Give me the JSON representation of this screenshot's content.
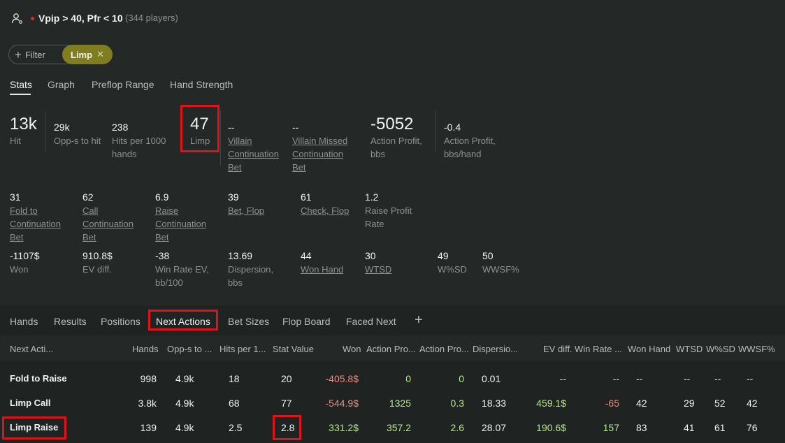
{
  "header": {
    "title": "Vpip > 40, Pfr < 10",
    "subtitle": "(344 players)"
  },
  "filters": {
    "add_label": "Filter",
    "active_chip": "Limp"
  },
  "tabs": [
    "Stats",
    "Graph",
    "Preflop Range",
    "Hand Strength"
  ],
  "stats_row1": [
    {
      "value": "13k",
      "label": "Hit"
    },
    {
      "value": "29k",
      "label": "Opp-s to hit"
    },
    {
      "value": "238",
      "label": "Hits per 1000 hands"
    },
    {
      "value": "47",
      "label": "Limp"
    },
    {
      "value": "--",
      "label": "Villain Continuation Bet"
    },
    {
      "value": "--",
      "label": "Villain Missed Continuation Bet"
    },
    {
      "value": "-5052",
      "label": "Action Profit, bbs"
    },
    {
      "value": "-0.4",
      "label": "Action Profit, bbs/hand"
    }
  ],
  "stats_row2": [
    {
      "value": "31",
      "label": "Fold to Continuation Bet"
    },
    {
      "value": "62",
      "label": "Call Continuation Bet"
    },
    {
      "value": "6.9",
      "label": "Raise Continuation Bet"
    },
    {
      "value": "39",
      "label": "Bet, Flop"
    },
    {
      "value": "61",
      "label": "Check, Flop"
    },
    {
      "value": "1.2",
      "label": "Raise Profit Rate"
    }
  ],
  "stats_row3": [
    {
      "value": "-1107$",
      "label": "Won"
    },
    {
      "value": "910.8$",
      "label": "EV diff."
    },
    {
      "value": "-38",
      "label": "Win Rate EV, bb/100"
    },
    {
      "value": "13.69",
      "label": "Dispersion, bbs"
    },
    {
      "value": "44",
      "label": "Won Hand"
    },
    {
      "value": "30",
      "label": "WTSD"
    },
    {
      "value": "49",
      "label": "W%SD"
    },
    {
      "value": "50",
      "label": "WWSF%"
    }
  ],
  "lower_tabs": [
    "Hands",
    "Results",
    "Positions",
    "Next Actions",
    "Bet Sizes",
    "Flop Board",
    "Faced Next",
    "+"
  ],
  "table": {
    "columns": [
      "Next Acti...",
      "Hands",
      "Opp-s to ...",
      "Hits per 1...",
      "Stat Value",
      "Won",
      "Action Pro...",
      "Action Pro...",
      "Dispersio...",
      "EV diff.",
      "Win Rate ...",
      "Won Hand",
      "WTSD",
      "W%SD",
      "WWSF%"
    ],
    "rows": [
      [
        "Fold to Raise",
        "998",
        "4.9k",
        "18",
        "20",
        "-405.8$",
        "0",
        "0",
        "0.01",
        "--",
        "--",
        "--",
        "--",
        "--",
        "--"
      ],
      [
        "Limp Call",
        "3.8k",
        "4.9k",
        "68",
        "77",
        "-544.9$",
        "1325",
        "0.3",
        "18.33",
        "459.1$",
        "-65",
        "42",
        "29",
        "52",
        "42"
      ],
      [
        "Limp Raise",
        "139",
        "4.9k",
        "2.5",
        "2.8",
        "331.2$",
        "357.2",
        "2.6",
        "28.07",
        "190.6$",
        "157",
        "83",
        "41",
        "61",
        "76"
      ]
    ]
  }
}
